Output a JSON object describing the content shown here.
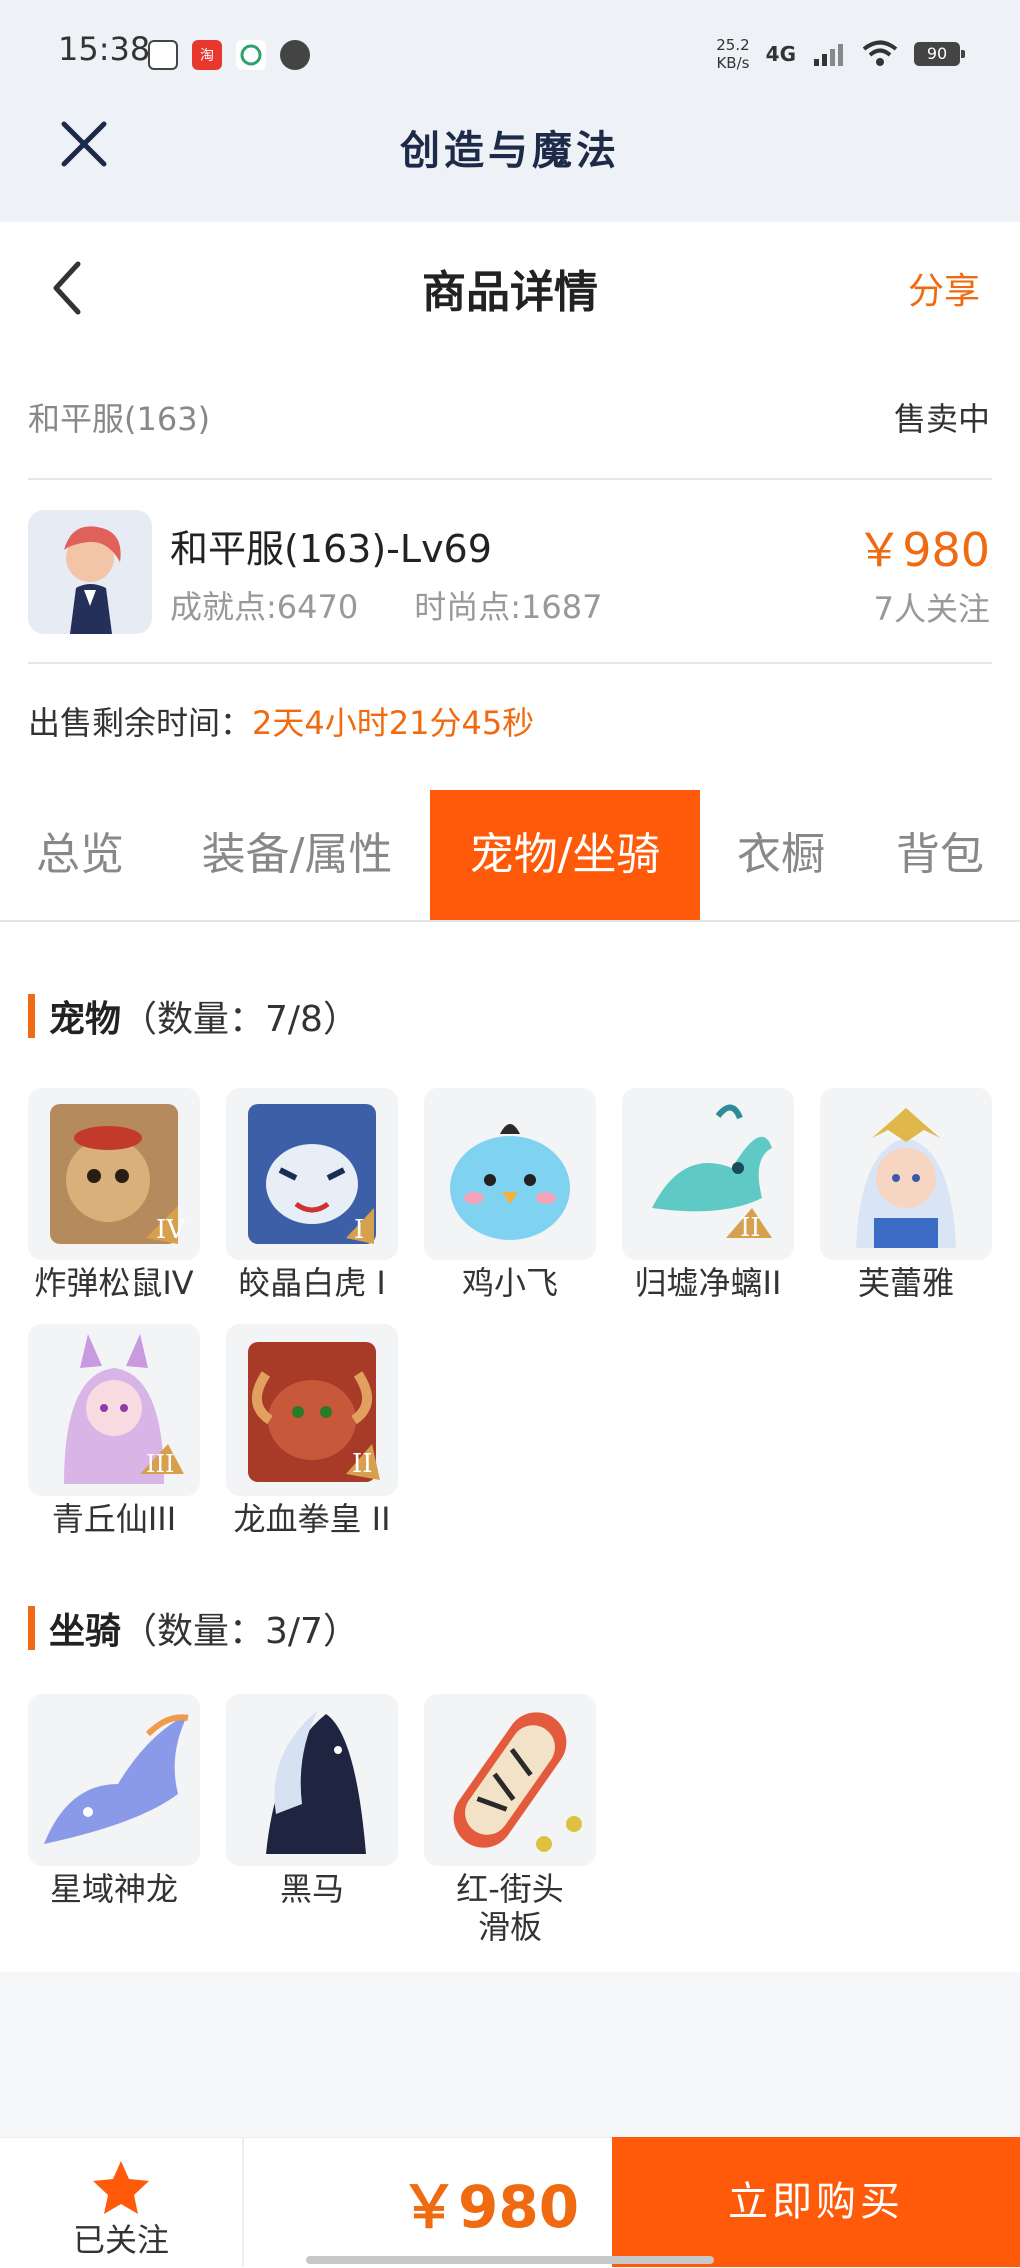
{
  "status_bar": {
    "time": "15:38",
    "speed_top": "25.2",
    "speed_bottom": "KB/s",
    "network": "4G",
    "battery": "90"
  },
  "app": {
    "title": "创造与魔法"
  },
  "header": {
    "title": "商品详情",
    "share_label": "分享"
  },
  "listing": {
    "server": "和平服(163)",
    "status": "售卖中",
    "account_name": "和平服(163)-Lv69",
    "achievement_points": "成就点:6470",
    "fashion_points": "时尚点:1687",
    "price": "￥980",
    "followers": "7人关注",
    "remaining_label": "出售剩余时间：",
    "remaining_value": "2天4小时21分45秒"
  },
  "tabs": [
    {
      "label": "总览"
    },
    {
      "label": "装备/属性"
    },
    {
      "label": "宠物/坐骑"
    },
    {
      "label": "衣橱"
    },
    {
      "label": "背包"
    }
  ],
  "active_tab": "宠物/坐骑",
  "pets": {
    "title": "宠物",
    "count": "（数量：7/8）",
    "items": [
      {
        "name": "炸弹松鼠IV",
        "icon": "squirrel-pet-icon",
        "color": "#c9a06a"
      },
      {
        "name": "皎晶白虎 I",
        "icon": "white-tiger-pet-icon",
        "color": "#7fa7d9"
      },
      {
        "name": "鸡小飞",
        "icon": "blue-chick-pet-icon",
        "color": "#7fd3f0"
      },
      {
        "name": "归墟净螭II",
        "icon": "sea-dragon-pet-icon",
        "color": "#5fc9c6"
      },
      {
        "name": "芙蕾雅",
        "icon": "fairy-girl-pet-icon",
        "color": "#f0d9a2"
      },
      {
        "name": "青丘仙III",
        "icon": "fox-fairy-pet-icon",
        "color": "#d9b4e6"
      },
      {
        "name": "龙血拳皇 II",
        "icon": "red-beast-pet-icon",
        "color": "#c8583a"
      }
    ]
  },
  "mounts": {
    "title": "坐骑",
    "count": "（数量：3/7）",
    "items": [
      {
        "name": "星域神龙",
        "icon": "star-dragon-mount-icon",
        "color": "#8a9ae8"
      },
      {
        "name": "黑马",
        "icon": "black-horse-mount-icon",
        "color": "#1f2540"
      },
      {
        "name": "红-街头滑板",
        "icon": "skateboard-mount-icon",
        "color": "#e35a3c"
      }
    ]
  },
  "bottom_bar": {
    "follow_label": "已关注",
    "price": "￥980",
    "buy_label": "立即购买"
  },
  "colors": {
    "accent": "#ff5a0a",
    "accent_text": "#ef6a10"
  }
}
